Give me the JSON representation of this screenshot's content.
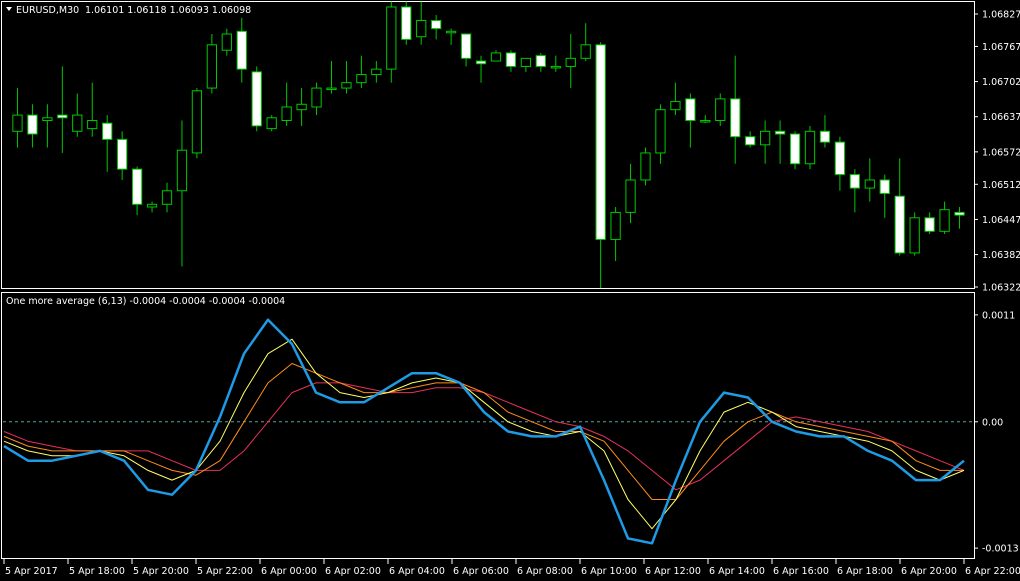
{
  "header": {
    "symbol_label": "EURUSD,M30",
    "ohlc": "1.06101 1.06118 1.06093 1.06098",
    "indicator_label": "One more average (6,13) -0.0004 -0.0004 -0.0004 -0.0004"
  },
  "colors": {
    "background": "#000000",
    "frame": "#ffffff",
    "bull_body": "#000000",
    "bear_body": "#ffffff",
    "candle_outline": "#00c800",
    "wick": "#00c800",
    "zero_line": "#5f9ea0",
    "ind_main": "#1e9be6",
    "ind_2": "#ffff66",
    "ind_3": "#ff8c1a",
    "ind_4": "#e8305a"
  },
  "chart_data": [
    {
      "type": "candlestick",
      "title": "EURUSD,M30",
      "price_ticks": [
        "1.06827",
        "1.06767",
        "1.06702",
        "1.06637",
        "1.06572",
        "1.06512",
        "1.06447",
        "1.06382",
        "1.06322"
      ],
      "ylim": [
        1.06322,
        1.06827
      ],
      "candles": [
        {
          "o": 1.0661,
          "h": 1.0669,
          "l": 1.0658,
          "c": 1.0664
        },
        {
          "o": 1.0664,
          "h": 1.0666,
          "l": 1.0658,
          "c": 1.06605
        },
        {
          "o": 1.0663,
          "h": 1.0666,
          "l": 1.0658,
          "c": 1.06635
        },
        {
          "o": 1.0664,
          "h": 1.0673,
          "l": 1.0657,
          "c": 1.06635
        },
        {
          "o": 1.0661,
          "h": 1.0668,
          "l": 1.066,
          "c": 1.0664
        },
        {
          "o": 1.06615,
          "h": 1.067,
          "l": 1.066,
          "c": 1.0663
        },
        {
          "o": 1.06625,
          "h": 1.0664,
          "l": 1.06535,
          "c": 1.06595
        },
        {
          "o": 1.06595,
          "h": 1.0661,
          "l": 1.0652,
          "c": 1.0654
        },
        {
          "o": 1.0654,
          "h": 1.06545,
          "l": 1.06455,
          "c": 1.06475
        },
        {
          "o": 1.0647,
          "h": 1.0648,
          "l": 1.0646,
          "c": 1.06475
        },
        {
          "o": 1.06475,
          "h": 1.06515,
          "l": 1.0646,
          "c": 1.065
        },
        {
          "o": 1.065,
          "h": 1.0663,
          "l": 1.0636,
          "c": 1.06575
        },
        {
          "o": 1.0657,
          "h": 1.0669,
          "l": 1.0656,
          "c": 1.06685
        },
        {
          "o": 1.0669,
          "h": 1.0679,
          "l": 1.0668,
          "c": 1.0677
        },
        {
          "o": 1.0676,
          "h": 1.068,
          "l": 1.0675,
          "c": 1.0679
        },
        {
          "o": 1.06795,
          "h": 1.0682,
          "l": 1.067,
          "c": 1.06725
        },
        {
          "o": 1.0672,
          "h": 1.0673,
          "l": 1.0661,
          "c": 1.0662
        },
        {
          "o": 1.06615,
          "h": 1.0664,
          "l": 1.0661,
          "c": 1.06635
        },
        {
          "o": 1.0663,
          "h": 1.067,
          "l": 1.0662,
          "c": 1.06655
        },
        {
          "o": 1.0665,
          "h": 1.0669,
          "l": 1.0662,
          "c": 1.0666
        },
        {
          "o": 1.06655,
          "h": 1.067,
          "l": 1.0664,
          "c": 1.0669
        },
        {
          "o": 1.0669,
          "h": 1.0674,
          "l": 1.0668,
          "c": 1.0669
        },
        {
          "o": 1.0669,
          "h": 1.0674,
          "l": 1.0668,
          "c": 1.067
        },
        {
          "o": 1.067,
          "h": 1.0675,
          "l": 1.0669,
          "c": 1.06715
        },
        {
          "o": 1.06715,
          "h": 1.0674,
          "l": 1.067,
          "c": 1.06725
        },
        {
          "o": 1.06725,
          "h": 1.0685,
          "l": 1.067,
          "c": 1.0684
        },
        {
          "o": 1.0684,
          "h": 1.0685,
          "l": 1.0677,
          "c": 1.0678
        },
        {
          "o": 1.06785,
          "h": 1.0685,
          "l": 1.0677,
          "c": 1.06815
        },
        {
          "o": 1.06815,
          "h": 1.06825,
          "l": 1.0678,
          "c": 1.068
        },
        {
          "o": 1.06795,
          "h": 1.068,
          "l": 1.0677,
          "c": 1.06795
        },
        {
          "o": 1.0679,
          "h": 1.0679,
          "l": 1.0673,
          "c": 1.06745
        },
        {
          "o": 1.0674,
          "h": 1.0675,
          "l": 1.067,
          "c": 1.06735
        },
        {
          "o": 1.0674,
          "h": 1.0676,
          "l": 1.0674,
          "c": 1.06755
        },
        {
          "o": 1.06755,
          "h": 1.0676,
          "l": 1.0672,
          "c": 1.0673
        },
        {
          "o": 1.0673,
          "h": 1.06745,
          "l": 1.0672,
          "c": 1.06745
        },
        {
          "o": 1.0675,
          "h": 1.06755,
          "l": 1.0672,
          "c": 1.0673
        },
        {
          "o": 1.0673,
          "h": 1.0675,
          "l": 1.0672,
          "c": 1.0673
        },
        {
          "o": 1.0673,
          "h": 1.0679,
          "l": 1.0669,
          "c": 1.06745
        },
        {
          "o": 1.06745,
          "h": 1.0681,
          "l": 1.0674,
          "c": 1.0677
        },
        {
          "o": 1.0677,
          "h": 1.06775,
          "l": 1.0632,
          "c": 1.0641
        },
        {
          "o": 1.0641,
          "h": 1.0647,
          "l": 1.0637,
          "c": 1.0646
        },
        {
          "o": 1.0646,
          "h": 1.0655,
          "l": 1.0644,
          "c": 1.0652
        },
        {
          "o": 1.0652,
          "h": 1.0658,
          "l": 1.0651,
          "c": 1.0657
        },
        {
          "o": 1.0657,
          "h": 1.0666,
          "l": 1.0655,
          "c": 1.0665
        },
        {
          "o": 1.0665,
          "h": 1.067,
          "l": 1.0664,
          "c": 1.06665
        },
        {
          "o": 1.0667,
          "h": 1.0668,
          "l": 1.0658,
          "c": 1.0663
        },
        {
          "o": 1.0663,
          "h": 1.0664,
          "l": 1.06625,
          "c": 1.0663
        },
        {
          "o": 1.0663,
          "h": 1.0668,
          "l": 1.0662,
          "c": 1.0667
        },
        {
          "o": 1.0667,
          "h": 1.0675,
          "l": 1.0655,
          "c": 1.066
        },
        {
          "o": 1.066,
          "h": 1.0661,
          "l": 1.0658,
          "c": 1.06585
        },
        {
          "o": 1.06585,
          "h": 1.0663,
          "l": 1.0655,
          "c": 1.0661
        },
        {
          "o": 1.0661,
          "h": 1.0663,
          "l": 1.0655,
          "c": 1.06605
        },
        {
          "o": 1.06605,
          "h": 1.0661,
          "l": 1.0654,
          "c": 1.0655
        },
        {
          "o": 1.0655,
          "h": 1.0662,
          "l": 1.0654,
          "c": 1.0661
        },
        {
          "o": 1.0661,
          "h": 1.0664,
          "l": 1.0658,
          "c": 1.0659
        },
        {
          "o": 1.0659,
          "h": 1.066,
          "l": 1.065,
          "c": 1.0653
        },
        {
          "o": 1.0653,
          "h": 1.0654,
          "l": 1.0646,
          "c": 1.06505
        },
        {
          "o": 1.06505,
          "h": 1.0656,
          "l": 1.0648,
          "c": 1.0652
        },
        {
          "o": 1.0652,
          "h": 1.0653,
          "l": 1.0645,
          "c": 1.06495
        },
        {
          "o": 1.0649,
          "h": 1.0656,
          "l": 1.0638,
          "c": 1.06385
        },
        {
          "o": 1.06385,
          "h": 1.0646,
          "l": 1.0638,
          "c": 1.0645
        },
        {
          "o": 1.0645,
          "h": 1.0646,
          "l": 1.0642,
          "c": 1.06425
        },
        {
          "o": 1.06425,
          "h": 1.0648,
          "l": 1.0642,
          "c": 1.06465
        },
        {
          "o": 1.0646,
          "h": 1.0647,
          "l": 1.0643,
          "c": 1.06455
        }
      ]
    },
    {
      "type": "line",
      "title": "One more average (6,13)",
      "ylim": [
        -0.00135,
        0.00115
      ],
      "y_ticks": [
        "0.0011",
        "0.00",
        "-0.0013"
      ],
      "zero_line": 0.0,
      "x_labels": [
        "5 Apr 2017",
        "5 Apr 18:00",
        "5 Apr 20:00",
        "5 Apr 22:00",
        "6 Apr 00:00",
        "6 Apr 02:00",
        "6 Apr 04:00",
        "6 Apr 06:00",
        "6 Apr 08:00",
        "6 Apr 10:00",
        "6 Apr 12:00",
        "6 Apr 14:00",
        "6 Apr 16:00",
        "6 Apr 18:00",
        "6 Apr 20:00",
        "6 Apr 22:00"
      ],
      "series": [
        {
          "color_key": "ind_main",
          "values": [
            -0.00025,
            -0.0004,
            -0.0004,
            -0.00035,
            -0.0003,
            -0.0004,
            -0.0007,
            -0.00075,
            -0.0005,
            5e-05,
            0.0007,
            0.00105,
            0.0008,
            0.0003,
            0.0002,
            0.0002,
            0.00035,
            0.0005,
            0.0005,
            0.0004,
            0.0001,
            -0.0001,
            -0.00015,
            -0.00015,
            -5e-05,
            -0.0006,
            -0.0012,
            -0.00125,
            -0.0006,
            0.0,
            0.0003,
            0.00025,
            0.0,
            -0.0001,
            -0.00015,
            -0.00015,
            -0.0003,
            -0.0004,
            -0.0006,
            -0.0006,
            -0.0004
          ]
        },
        {
          "color_key": "ind_2",
          "values": [
            -0.0002,
            -0.0003,
            -0.00035,
            -0.00035,
            -0.0003,
            -0.00035,
            -0.0005,
            -0.0006,
            -0.0005,
            -0.0002,
            0.0003,
            0.0007,
            0.00085,
            0.0005,
            0.0003,
            0.00025,
            0.0003,
            0.0004,
            0.00045,
            0.0004,
            0.0002,
            0.0,
            -0.0001,
            -0.00015,
            -0.0001,
            -0.0003,
            -0.0008,
            -0.0011,
            -0.0008,
            -0.0003,
            0.0001,
            0.0002,
            0.0001,
            -5e-05,
            -0.0001,
            -0.00015,
            -0.0002,
            -0.0003,
            -0.0005,
            -0.0006,
            -0.0005
          ]
        },
        {
          "color_key": "ind_3",
          "values": [
            -0.00015,
            -0.00025,
            -0.0003,
            -0.0003,
            -0.0003,
            -0.0003,
            -0.0004,
            -0.0005,
            -0.00055,
            -0.0004,
            0.0,
            0.0004,
            0.0006,
            0.0005,
            0.0004,
            0.0003,
            0.0003,
            0.00035,
            0.0004,
            0.0004,
            0.0003,
            0.0001,
            0.0,
            -0.0001,
            -0.0001,
            -0.0002,
            -0.0005,
            -0.0008,
            -0.0008,
            -0.0005,
            -0.0002,
            0.0,
            0.0001,
            0.0,
            -5e-05,
            -0.0001,
            -0.00015,
            -0.0002,
            -0.0004,
            -0.0005,
            -0.0005
          ]
        },
        {
          "color_key": "ind_4",
          "values": [
            -0.0001,
            -0.0002,
            -0.00025,
            -0.0003,
            -0.0003,
            -0.0003,
            -0.0003,
            -0.0004,
            -0.0005,
            -0.0005,
            -0.0003,
            0.0,
            0.0003,
            0.0004,
            0.0004,
            0.00035,
            0.0003,
            0.0003,
            0.00035,
            0.00035,
            0.0003,
            0.0002,
            0.0001,
            0.0,
            -5e-05,
            -0.00015,
            -0.0003,
            -0.0005,
            -0.0007,
            -0.0006,
            -0.0004,
            -0.0002,
            0.0,
            5e-05,
            0.0,
            -5e-05,
            -0.0001,
            -0.0002,
            -0.0003,
            -0.0004,
            -0.0005
          ]
        }
      ]
    }
  ]
}
